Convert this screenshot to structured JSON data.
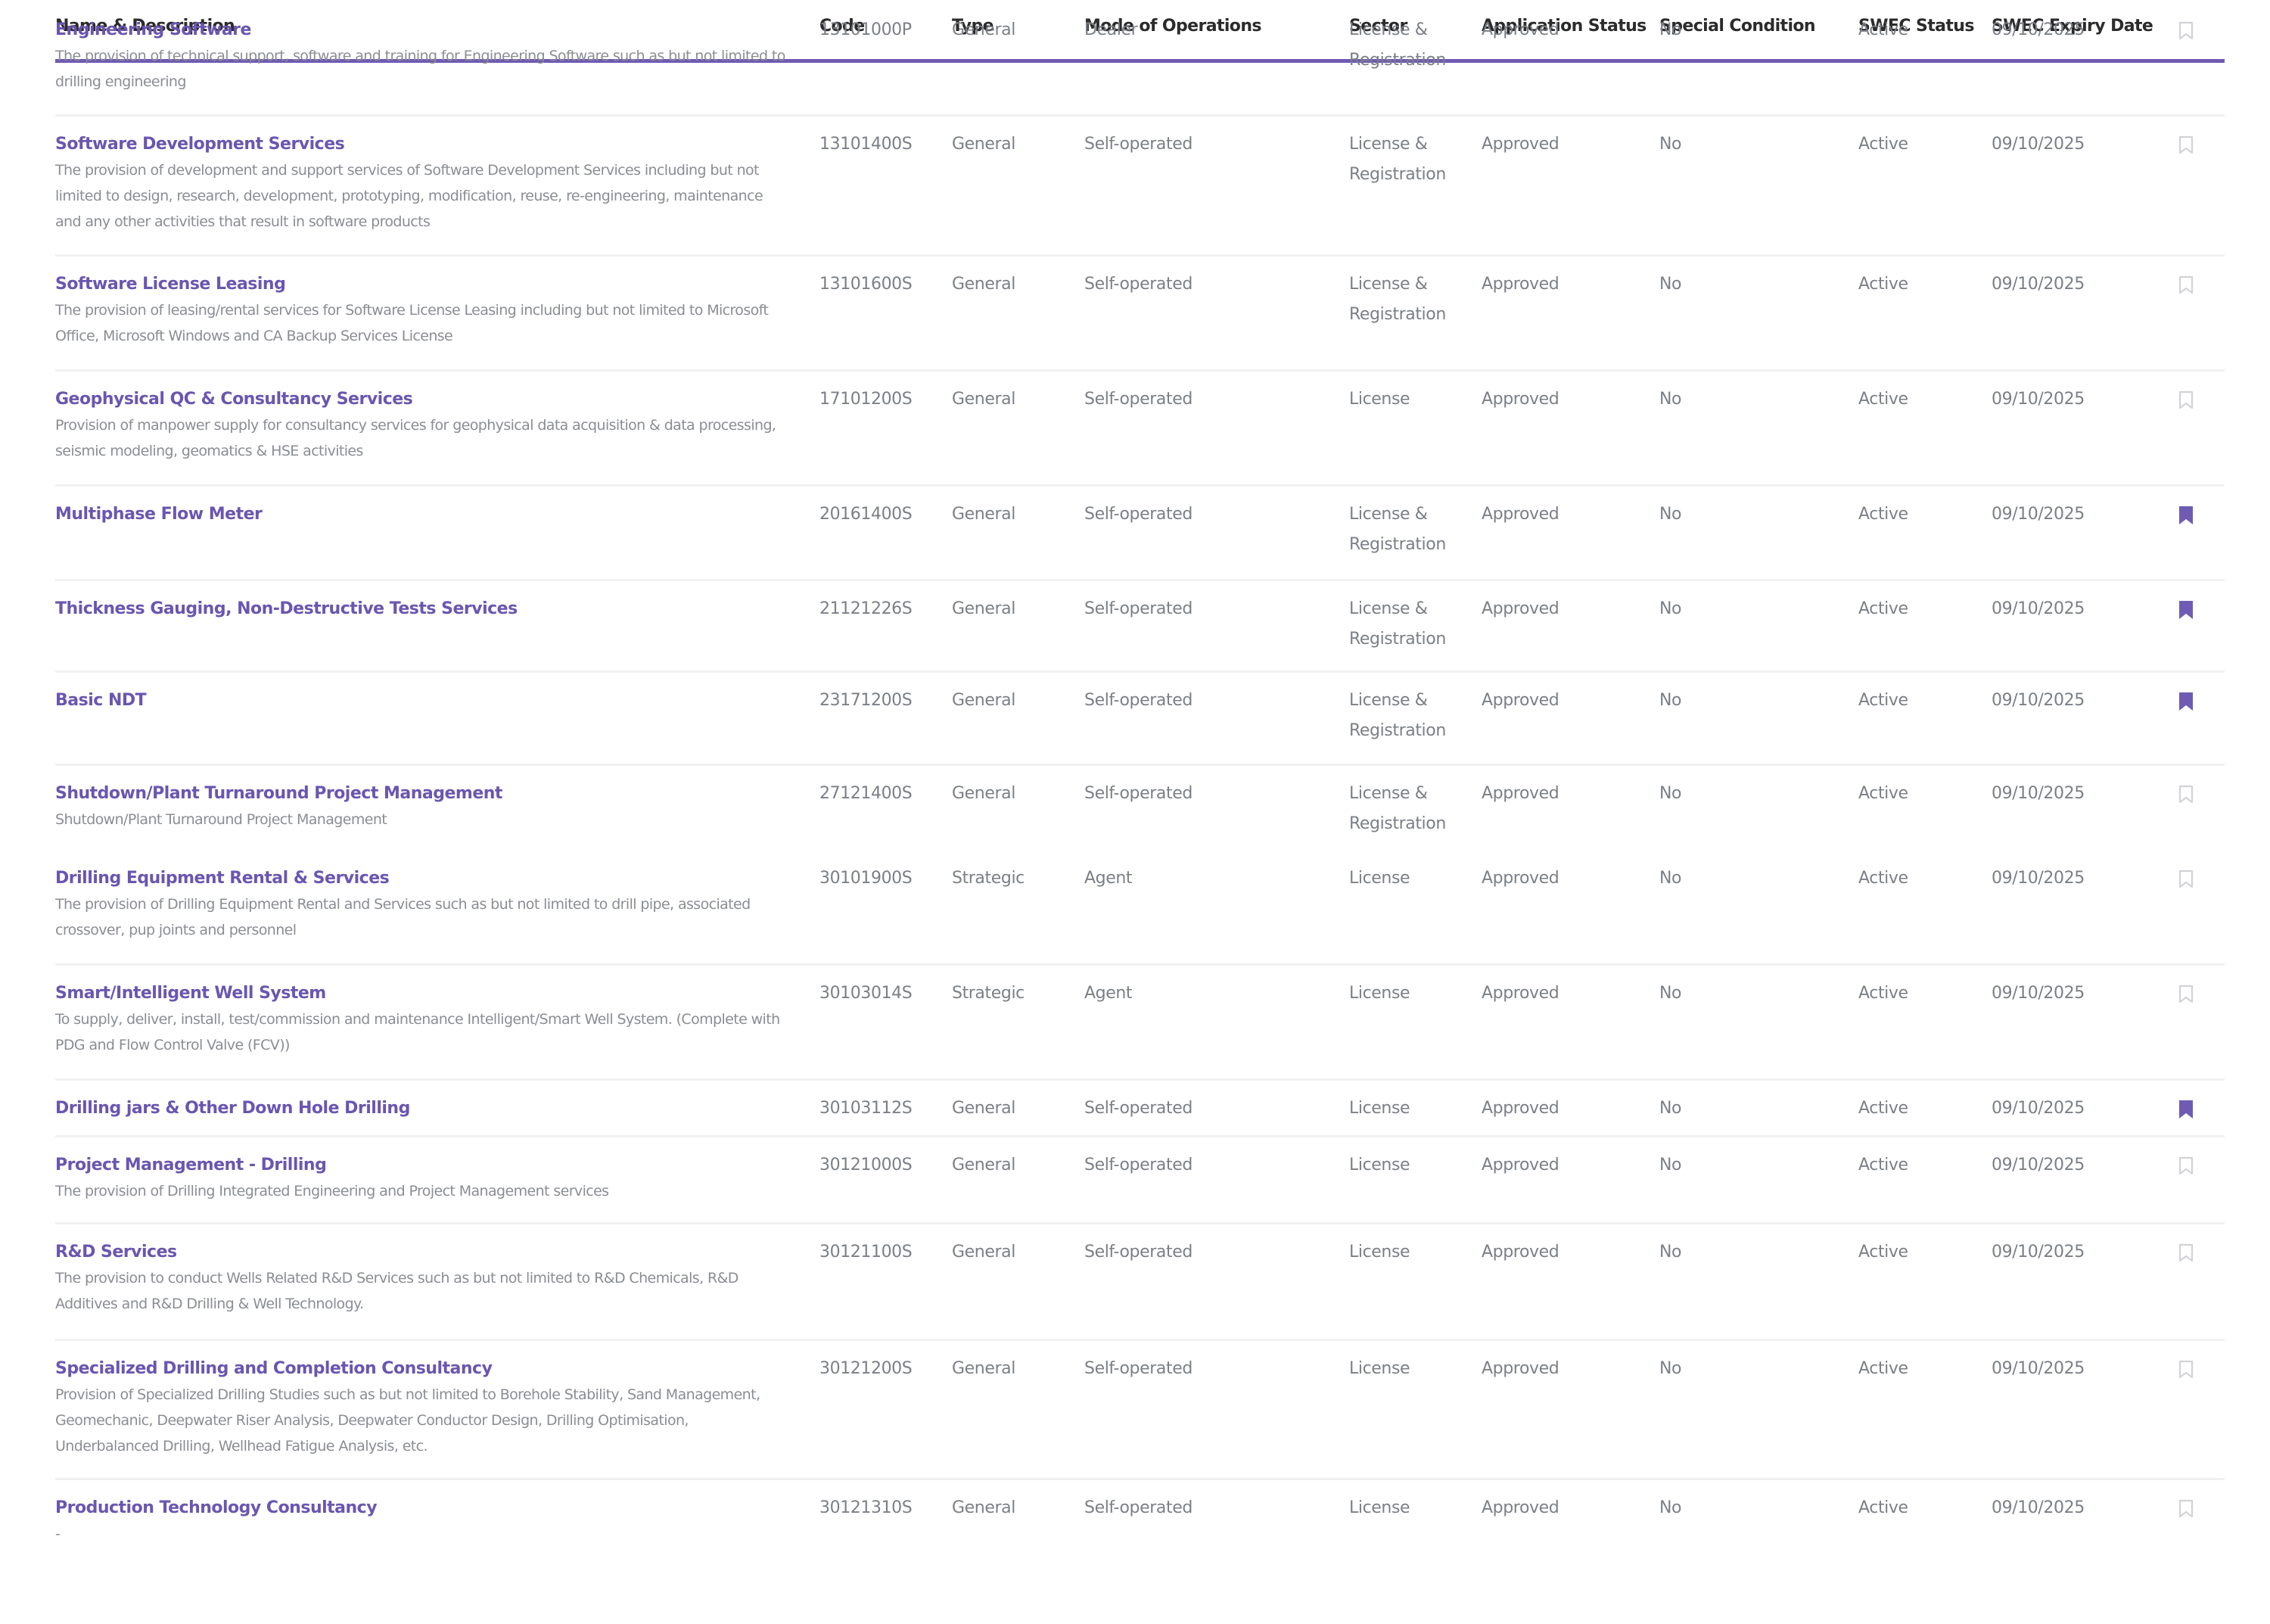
{
  "accent_color": "#6f5bb3",
  "columns": {
    "name": "Name & Description",
    "code": "Code",
    "type": "Type",
    "mode": "Mode of Operations",
    "sector": "Sector",
    "app_status": "Application Status",
    "special": "Special Condition",
    "swec_status": "SWEC Status",
    "expiry": "SWEC Expiry Date"
  },
  "rows": [
    {
      "title": "Engineering Software",
      "desc": "The provision of technical support, software and training for Engineering Software such as but not limited to drilling engineering",
      "code": "13101000P",
      "type": "General",
      "mode": "Dealer",
      "sector": "License & Registration",
      "app_status": "Approved",
      "special": "No",
      "swec_status": "Active",
      "expiry": "09/10/2025",
      "bookmarked": false
    },
    {
      "title": "Software Development Services",
      "desc": "The provision of development and support services of Software Development Services including but not limited to design, research, development, prototyping, modification, reuse, re-engineering, maintenance and any other activities that result in software products",
      "code": "13101400S",
      "type": "General",
      "mode": "Self-operated",
      "sector": "License & Registration",
      "app_status": "Approved",
      "special": "No",
      "swec_status": "Active",
      "expiry": "09/10/2025",
      "bookmarked": false
    },
    {
      "title": "Software License Leasing",
      "desc": "The provision of leasing/rental services for Software License Leasing including but not limited to Microsoft Office, Microsoft Windows and CA Backup Services License",
      "code": "13101600S",
      "type": "General",
      "mode": "Self-operated",
      "sector": "License & Registration",
      "app_status": "Approved",
      "special": "No",
      "swec_status": "Active",
      "expiry": "09/10/2025",
      "bookmarked": false
    },
    {
      "title": "Geophysical QC & Consultancy Services",
      "desc": "Provision of manpower supply for consultancy services for geophysical data acquisition & data processing, seismic modeling, geomatics & HSE activities",
      "code": "17101200S",
      "type": "General",
      "mode": "Self-operated",
      "sector": "License",
      "app_status": "Approved",
      "special": "No",
      "swec_status": "Active",
      "expiry": "09/10/2025",
      "bookmarked": false
    },
    {
      "title": "Multiphase Flow Meter",
      "desc": "",
      "code": "20161400S",
      "type": "General",
      "mode": "Self-operated",
      "sector": "License & Registration",
      "app_status": "Approved",
      "special": "No",
      "swec_status": "Active",
      "expiry": "09/10/2025",
      "bookmarked": true
    },
    {
      "title": "Thickness Gauging, Non-Destructive Tests Services",
      "desc": "",
      "code": "21121226S",
      "type": "General",
      "mode": "Self-operated",
      "sector": "License & Registration",
      "app_status": "Approved",
      "special": "No",
      "swec_status": "Active",
      "expiry": "09/10/2025",
      "bookmarked": true
    },
    {
      "title": "Basic NDT",
      "desc": "",
      "code": "23171200S",
      "type": "General",
      "mode": "Self-operated",
      "sector": "License & Registration",
      "app_status": "Approved",
      "special": "No",
      "swec_status": "Active",
      "expiry": "09/10/2025",
      "bookmarked": true
    },
    {
      "title": "Shutdown/Plant Turnaround Project Management",
      "desc": "Shutdown/Plant Turnaround Project Management",
      "code": "27121400S",
      "type": "General",
      "mode": "Self-operated",
      "sector": "License & Registration",
      "app_status": "Approved",
      "special": "No",
      "swec_status": "Active",
      "expiry": "09/10/2025",
      "bookmarked": false
    },
    {
      "title": "Drilling Equipment Rental & Services",
      "desc": "The provision of Drilling Equipment Rental and Services such as but not limited to drill pipe, associated crossover, pup joints and personnel",
      "code": "30101900S",
      "type": "Strategic",
      "mode": "Agent",
      "sector": "License",
      "app_status": "Approved",
      "special": "No",
      "swec_status": "Active",
      "expiry": "09/10/2025",
      "bookmarked": false
    },
    {
      "title": "Smart/Intelligent Well System",
      "desc": "To supply, deliver, install, test/commission and maintenance Intelligent/Smart Well System. (Complete with PDG and Flow Control Valve (FCV))",
      "code": "30103014S",
      "type": "Strategic",
      "mode": "Agent",
      "sector": "License",
      "app_status": "Approved",
      "special": "No",
      "swec_status": "Active",
      "expiry": "09/10/2025",
      "bookmarked": false
    },
    {
      "title": "Drilling jars & Other Down Hole Drilling",
      "desc": "",
      "code": "30103112S",
      "type": "General",
      "mode": "Self-operated",
      "sector": "License",
      "app_status": "Approved",
      "special": "No",
      "swec_status": "Active",
      "expiry": "09/10/2025",
      "bookmarked": true
    },
    {
      "title": "Project Management - Drilling",
      "desc": "The provision of Drilling Integrated Engineering and Project Management services",
      "code": "30121000S",
      "type": "General",
      "mode": "Self-operated",
      "sector": "License",
      "app_status": "Approved",
      "special": "No",
      "swec_status": "Active",
      "expiry": "09/10/2025",
      "bookmarked": false
    },
    {
      "title": "R&D Services",
      "desc": "The provision to conduct Wells Related R&D Services such as but not limited to R&D Chemicals, R&D Additives and R&D Drilling & Well Technology.",
      "code": "30121100S",
      "type": "General",
      "mode": "Self-operated",
      "sector": "License",
      "app_status": "Approved",
      "special": "No",
      "swec_status": "Active",
      "expiry": "09/10/2025",
      "bookmarked": false
    },
    {
      "title": "Specialized Drilling and Completion Consultancy",
      "desc": "Provision of Specialized Drilling Studies such as but not limited to Borehole Stability, Sand Management, Geomechanic, Deepwater Riser Analysis, Deepwater Conductor Design, Drilling Optimisation, Underbalanced Drilling, Wellhead Fatigue Analysis, etc.",
      "code": "30121200S",
      "type": "General",
      "mode": "Self-operated",
      "sector": "License",
      "app_status": "Approved",
      "special": "No",
      "swec_status": "Active",
      "expiry": "09/10/2025",
      "bookmarked": false
    },
    {
      "title": "Production Technology Consultancy",
      "desc": "-",
      "code": "30121310S",
      "type": "General",
      "mode": "Self-operated",
      "sector": "License",
      "app_status": "Approved",
      "special": "No",
      "swec_status": "Active",
      "expiry": "09/10/2025",
      "bookmarked": false
    }
  ]
}
